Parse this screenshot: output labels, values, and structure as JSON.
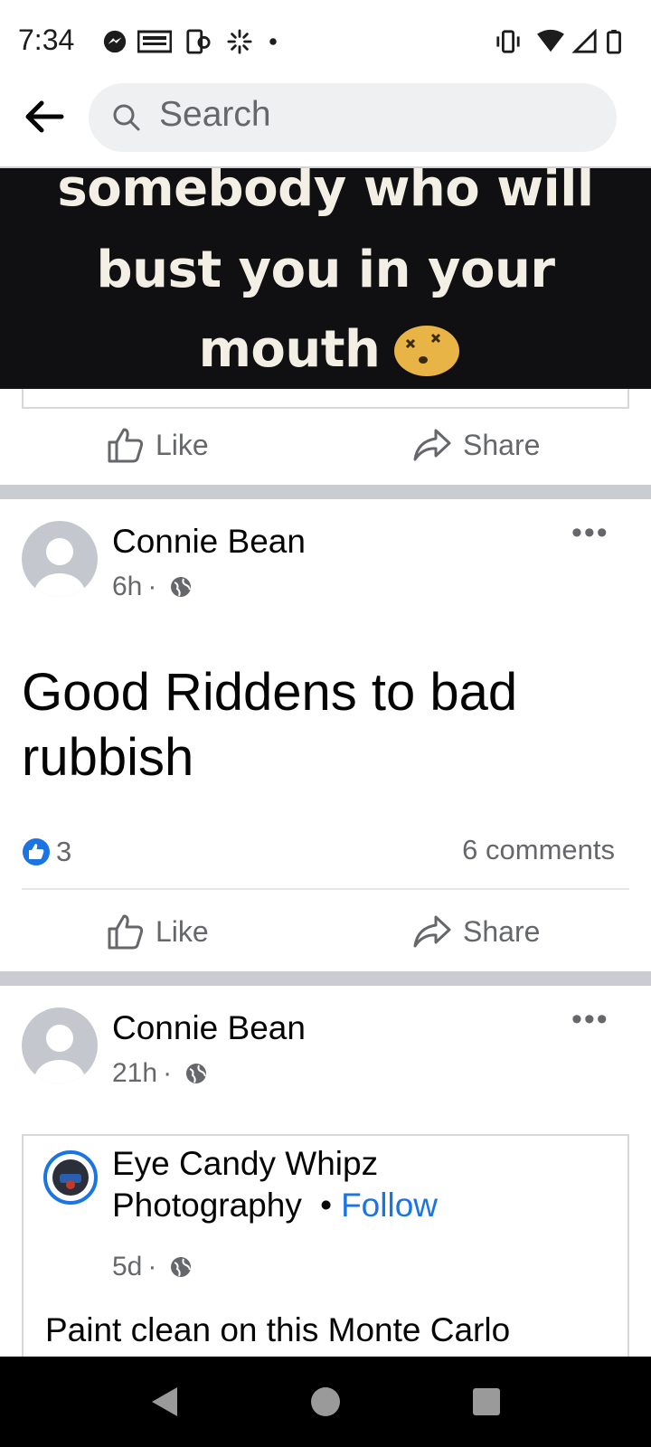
{
  "status_bar": {
    "time": "7:34"
  },
  "search": {
    "placeholder": "Search"
  },
  "meme": {
    "lines": [
      "somebody who will",
      "bust you in your",
      "mouth"
    ]
  },
  "post1_actions": {
    "like": "Like",
    "share": "Share"
  },
  "post2": {
    "author": "Connie Bean",
    "time": "6h",
    "text": "Good Riddens to bad rubbish",
    "reaction_count": "3",
    "comments": "6 comments",
    "like": "Like",
    "share": "Share"
  },
  "post3": {
    "author": "Connie Bean",
    "time": "21h",
    "shared": {
      "page_name_line1": "Eye Candy Whipz",
      "page_name_line2": "Photography",
      "separator": "•",
      "follow": "Follow",
      "time": "5d",
      "text": "Paint clean on this Monte Carlo"
    }
  },
  "colors": {
    "accent": "#1b74e4",
    "secondary_text": "#65676b",
    "divider": "#c9ccd1"
  },
  "icons": [
    "messenger-icon",
    "news-icon",
    "phone-sync-icon",
    "loading-icon",
    "vibrate-icon",
    "wifi-icon",
    "cell-signal-icon",
    "battery-icon",
    "back-arrow-icon",
    "search-icon",
    "like-icon",
    "share-icon",
    "globe-icon",
    "more-icon"
  ]
}
